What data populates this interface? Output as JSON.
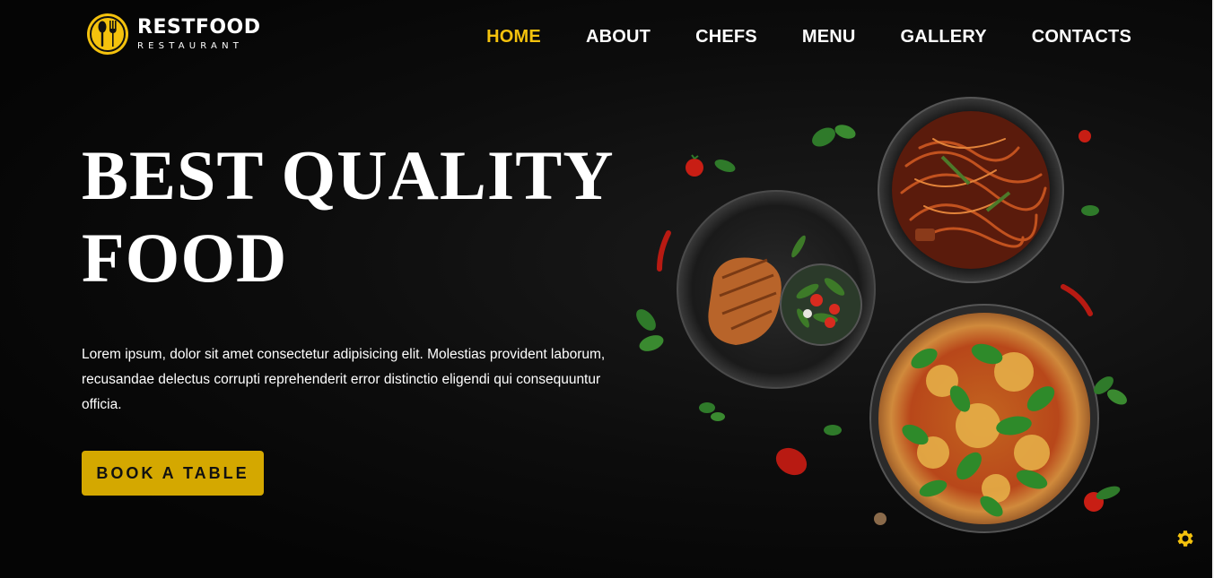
{
  "brand": {
    "name": "RESTFOOD",
    "tagline": "RESTAURANT",
    "accent": "#f4c20d"
  },
  "nav": {
    "items": [
      {
        "label": "HOME",
        "active": true
      },
      {
        "label": "ABOUT",
        "active": false
      },
      {
        "label": "CHEFS",
        "active": false
      },
      {
        "label": "MENU",
        "active": false
      },
      {
        "label": "GALLERY",
        "active": false
      },
      {
        "label": "CONTACTS",
        "active": false
      }
    ]
  },
  "hero": {
    "title_line1": "BEST QUALITY",
    "title_line2": "FOOD",
    "description": "Lorem ipsum, dolor sit amet consectetur adipisicing elit. Molestias provident laborum, recusandae delectus corrupti reprehenderit error distinctio eligendi qui consequuntur officia.",
    "cta_label": "BOOK A TABLE",
    "cta_color": "#d4a800"
  },
  "icons": {
    "logo": "spoon-fork-icon",
    "settings": "gear-icon"
  }
}
